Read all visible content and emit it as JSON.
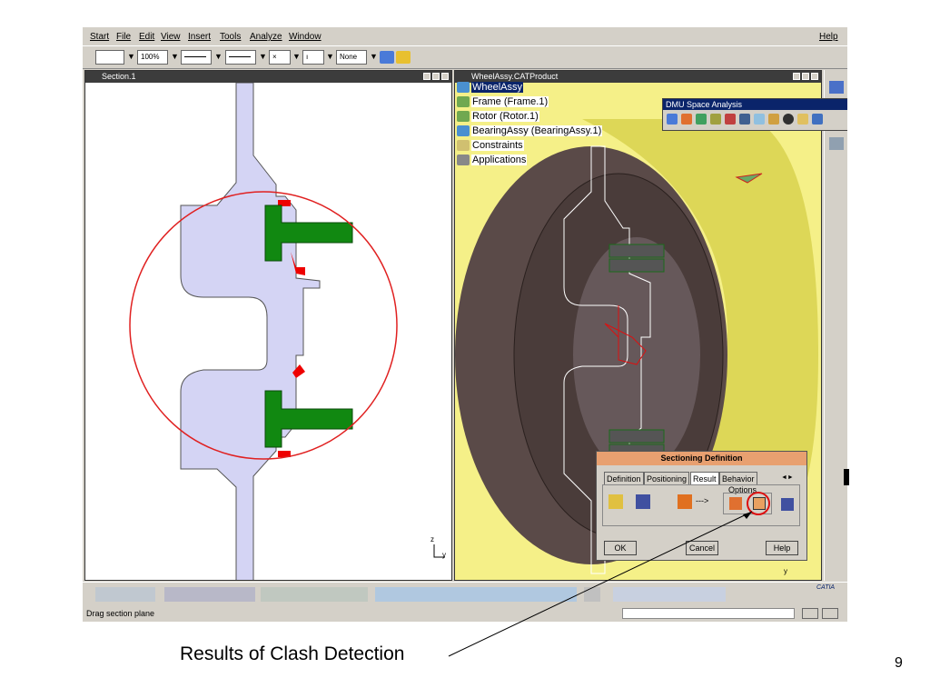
{
  "menubar": {
    "items": [
      "Start",
      "File",
      "Edit",
      "View",
      "Insert",
      "Tools",
      "Analyze",
      "Window"
    ],
    "help": "Help"
  },
  "toolbar": {
    "zoom": "100%",
    "layer": "None"
  },
  "section_window": {
    "title": "Section.1",
    "axis_z": "z",
    "axis_y": "y"
  },
  "product_window": {
    "title": "WheelAssy.CATProduct",
    "tree": [
      {
        "label": "WheelAssy",
        "icon": "product-icon"
      },
      {
        "label": "Frame (Frame.1)",
        "icon": "part-icon"
      },
      {
        "label": "Rotor (Rotor.1)",
        "icon": "part-icon"
      },
      {
        "label": "BearingAssy (BearingAssy.1)",
        "icon": "product-icon"
      },
      {
        "label": "Constraints",
        "icon": "constraints-icon"
      },
      {
        "label": "Applications",
        "icon": "applications-icon"
      }
    ]
  },
  "dmu_toolbar": {
    "title": "DMU Space Analysis"
  },
  "dialog": {
    "title": "Sectioning Definition",
    "tabs": [
      "Definition",
      "Positioning",
      "Result",
      "Behavior"
    ],
    "active_tab": "Result",
    "options_label": "Options",
    "arrow": "--->",
    "ok": "OK",
    "cancel": "Cancel",
    "help": "Help"
  },
  "status": {
    "text": "Drag section plane"
  },
  "caption": "Results of Clash Detection",
  "slide_number": "9",
  "colors": {
    "section_fill": "#d4d4f4",
    "bolt_green": "#118811",
    "clash_red": "#ee0000",
    "viewport_bg": "#f5f088",
    "titlebar_dark": "#3c3c3c",
    "selection_blue": "#0a246a"
  }
}
